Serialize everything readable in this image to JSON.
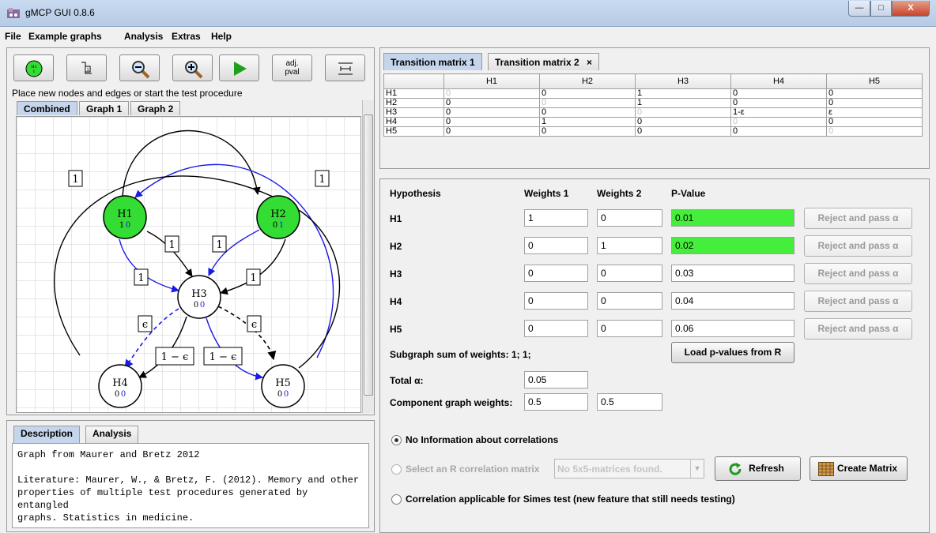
{
  "window": {
    "title": "gMCP GUI 0.8.6",
    "min_label": "—",
    "max_label": "□",
    "close_label": "X"
  },
  "menu": [
    "File",
    "Example graphs",
    "Analysis",
    "Extras",
    "Help"
  ],
  "toolbar": {
    "adj_label_1": "adj.",
    "adj_label_2": "pval"
  },
  "hint": "Place new nodes and edges or start the test procedure",
  "graph_tabs": [
    "Combined",
    "Graph 1",
    "Graph 2"
  ],
  "graph": {
    "nodes": [
      {
        "id": "H1",
        "w1": "1",
        "w2": "0",
        "color": "#33dd33"
      },
      {
        "id": "H2",
        "w1": "0",
        "w2": "1",
        "color": "#33dd33"
      },
      {
        "id": "H3",
        "w1": "0",
        "w2": "0",
        "color": "#ffffff"
      },
      {
        "id": "H4",
        "w1": "0",
        "w2": "0",
        "color": "#ffffff"
      },
      {
        "id": "H5",
        "w1": "0",
        "w2": "0",
        "color": "#ffffff"
      }
    ],
    "edge_labels": [
      "1",
      "1",
      "1",
      "1",
      "1",
      "1",
      "1",
      "1",
      "ϵ",
      "ϵ",
      "1 − ϵ",
      "1 − ϵ"
    ],
    "colors": {
      "graph1": "#000000",
      "graph2": "#1a1ae6",
      "node_weight2": "#1a1ae6"
    }
  },
  "desc_tabs": [
    "Description",
    "Analysis"
  ],
  "description": {
    "line1": "Graph from Maurer and Bretz 2012",
    "line2": "Literature: Maurer, W., & Bretz, F. (2012). Memory and other",
    "line3": "properties of multiple test procedures generated by entangled",
    "line4": "graphs. Statistics in medicine."
  },
  "tm_tabs": [
    "Transition matrix 1",
    "Transition matrix 2"
  ],
  "tm_close": "×",
  "tm_headers": [
    "",
    "H1",
    "H2",
    "H3",
    "H4",
    "H5"
  ],
  "tm_rows": [
    [
      "H1",
      "0",
      "0",
      "1",
      "0",
      "0"
    ],
    [
      "H2",
      "0",
      "0",
      "1",
      "0",
      "0"
    ],
    [
      "H3",
      "0",
      "0",
      "0",
      "1-ε",
      "ε"
    ],
    [
      "H4",
      "0",
      "1",
      "0",
      "0",
      "0"
    ],
    [
      "H5",
      "0",
      "0",
      "0",
      "0",
      "0"
    ]
  ],
  "hyp": {
    "headers": {
      "hypothesis": "Hypothesis",
      "w1": "Weights 1",
      "w2": "Weights 2",
      "pval": "P-Value"
    },
    "rows": [
      {
        "name": "H1",
        "w1": "1",
        "w2": "0",
        "p": "0.01",
        "highlight": true
      },
      {
        "name": "H2",
        "w1": "0",
        "w2": "1",
        "p": "0.02",
        "highlight": true
      },
      {
        "name": "H3",
        "w1": "0",
        "w2": "0",
        "p": "0.03",
        "highlight": false
      },
      {
        "name": "H4",
        "w1": "0",
        "w2": "0",
        "p": "0.04",
        "highlight": false
      },
      {
        "name": "H5",
        "w1": "0",
        "w2": "0",
        "p": "0.06",
        "highlight": false
      }
    ],
    "reject_label": "Reject and pass α",
    "subgraph_sum": "Subgraph sum of weights: 1; 1;",
    "load_label": "Load p-values from R",
    "total_alpha_label": "Total α:",
    "total_alpha": "0.05",
    "cgw_label": "Component graph weights:",
    "cgw1": "0.5",
    "cgw2": "0.5",
    "radio1": "No Information about correlations",
    "radio2": "Select an R correlation matrix",
    "radio2_select": "No 5x5-matrices found.",
    "refresh": "Refresh",
    "create_matrix": "Create Matrix",
    "radio3": "Correlation applicable for Simes test (new feature that still needs testing)"
  }
}
